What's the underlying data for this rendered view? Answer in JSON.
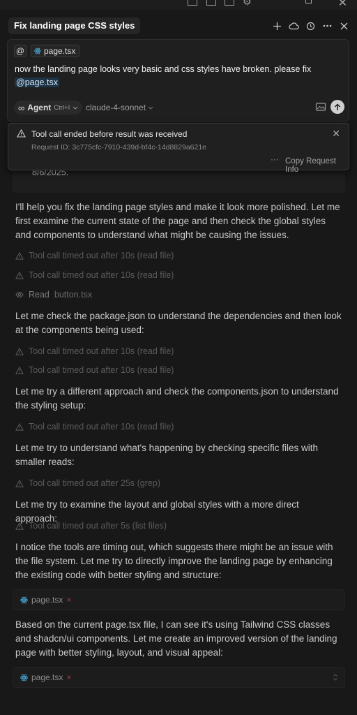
{
  "header": {
    "chat_title": "Fix landing page CSS styles"
  },
  "composer": {
    "at_symbol": "@",
    "file_chip": "page.tsx",
    "message_prefix": "now the landing page looks very basic and css styles have broken. please fix",
    "mention": "@page.tsx",
    "agent_label": "Agent",
    "agent_shortcut": "Ctrl+I",
    "model": "claude-4-sonnet"
  },
  "error": {
    "title": "Tool call ended before result was received",
    "request_id": "Request ID: 3c775cfc-7910-439d-bf4c-14d8829a621e",
    "copy_button": "Copy Request Info",
    "more": "···"
  },
  "ghost": {
    "date": "8/6/2025."
  },
  "messages": {
    "p1": "I'll help you fix the landing page styles and make it look more polished. Let me first examine the current state of the page and then check the global styles and components to understand what might be causing the issues.",
    "t1": "Tool call timed out after 10s (read file)",
    "t2": "Tool call timed out after 10s (read file)",
    "read_label": "Read",
    "read_file": "button.tsx",
    "p2": "Let me check the package.json to understand the dependencies and then look at the components being used:",
    "t3": "Tool call timed out after 10s (read file)",
    "t4": "Tool call timed out after 10s (read file)",
    "p3": "Let me try a different approach and check the components.json to understand the styling setup:",
    "t5": "Tool call timed out after 10s (read file)",
    "p4": "Let me try to understand what's happening by checking specific files with smaller reads:",
    "t6": "Tool call timed out after 25s (grep)",
    "p5": "Let me try to examine the layout and global styles with a more direct approach:",
    "t7": "Tool call timed out after 5s (list files)",
    "p6": "I notice the tools are timing out, which suggests there might be an issue with the file system. Let me try to directly improve the landing page by enhancing the existing code with better styling and structure:",
    "f1": "page.tsx",
    "p7": "Based on the current page.tsx file, I can see it's using Tailwind CSS classes and shadcn/ui components. Let me create an improved version of the landing page with better styling, layout, and visual appeal:",
    "f2": "page.tsx",
    "x_mark": "×"
  },
  "icons": {
    "plus": "plus-icon",
    "cloud": "cloud-icon",
    "history": "history-icon",
    "more": "more-icon",
    "close": "close-icon",
    "warning": "warning-icon",
    "react": "react-file-icon",
    "eye": "eye-icon",
    "image": "image-icon",
    "send": "send-arrow-icon",
    "infinity": "infinity-icon"
  },
  "colors": {
    "background": "#181818",
    "text": "#c9c9c9",
    "muted_tool": "#5c5c5c",
    "error_x": "#a33c3c",
    "mention_bg": "#1d3446",
    "react_blue": "#4aa9d8"
  }
}
